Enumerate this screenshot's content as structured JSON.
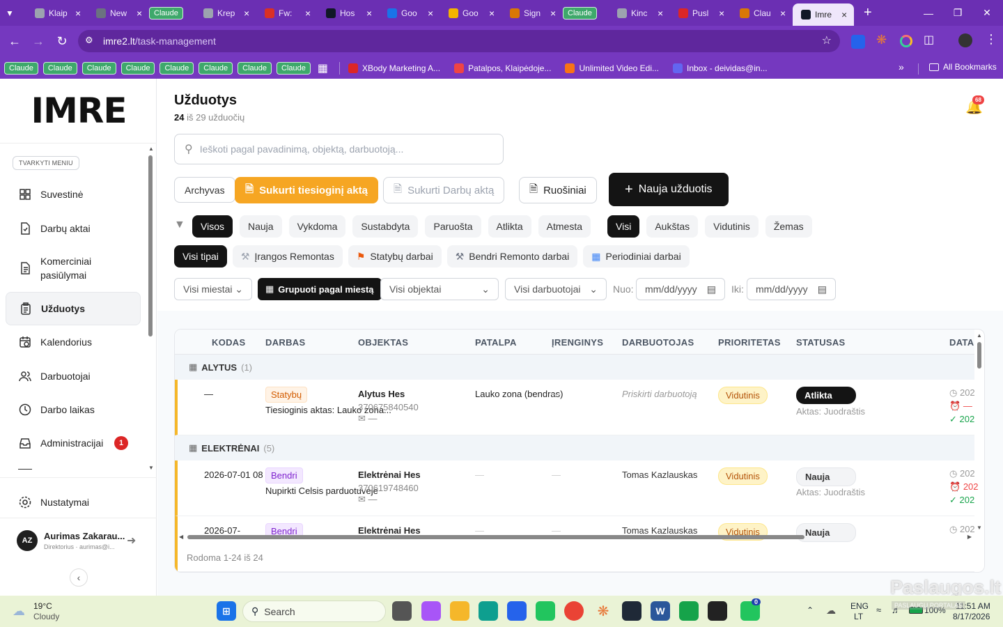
{
  "browser": {
    "tabs": [
      {
        "title": "Klaip",
        "color": "#9ca3af"
      },
      {
        "title": "New",
        "color": "#6b7280"
      },
      {
        "title": "Claude",
        "grouped": true
      },
      {
        "title": "Krep",
        "color": "#9ca3af"
      },
      {
        "title": "Fw:",
        "color": "#d93025"
      },
      {
        "title": "Hos",
        "color": "#111827"
      },
      {
        "title": "Goo",
        "color": "#1a73e8"
      },
      {
        "title": "Goo",
        "color": "#f4b400"
      },
      {
        "title": "Sign",
        "color": "#d97706"
      },
      {
        "title": "Claude",
        "grouped": true
      },
      {
        "title": "Kinc",
        "color": "#9ca3af"
      },
      {
        "title": "Pusl",
        "color": "#dc2626"
      },
      {
        "title": "Clau",
        "color": "#d97706"
      },
      {
        "title": "Imre",
        "color": "#111827",
        "active": true
      }
    ],
    "url_host": "imre2.lt",
    "url_path": "/task-management",
    "bookmarks": {
      "claude_chips": [
        "Claude",
        "Claude",
        "Claude",
        "Claude",
        "Claude",
        "Claude",
        "Claude",
        "Claude"
      ],
      "links": [
        {
          "label": "XBody Marketing A...",
          "color": "#dc2626"
        },
        {
          "label": "Patalpos, Klaipėdoje...",
          "color": "#ef4444"
        },
        {
          "label": "Unlimited Video Edi...",
          "color": "#f97316"
        },
        {
          "label": "Inbox - deividas@in...",
          "color": "#6366f1"
        }
      ],
      "all_bookmarks": "All Bookmarks"
    }
  },
  "sidebar": {
    "logo": "IMRE",
    "manage_menu": "TVARKYTI MENIU",
    "items": [
      {
        "label": "Suvestinė",
        "icon": "grid-icon"
      },
      {
        "label": "Darbų aktai",
        "icon": "document-check-icon"
      },
      {
        "label": "Komerciniai pasiūlymai",
        "icon": "document-text-icon"
      },
      {
        "label": "Užduotys",
        "icon": "clipboard-icon",
        "active": true
      },
      {
        "label": "Kalendorius",
        "icon": "calendar-icon"
      },
      {
        "label": "Darbuotojai",
        "icon": "users-icon"
      },
      {
        "label": "Darbo laikas",
        "icon": "clock-icon"
      },
      {
        "label": "Administracijai",
        "icon": "inbox-icon",
        "badge": "1"
      }
    ],
    "settings": "Nustatymai",
    "user": {
      "initials": "AZ",
      "name": "Aurimas Zakarau...",
      "role": "Direktorius · aurimas@i..."
    }
  },
  "header": {
    "title": "Užduotys",
    "count_shown": "24",
    "count_rest": "iš 29 užduočių",
    "notifications": "68"
  },
  "search": {
    "placeholder": "Ieškoti pagal pavadinimą, objektą, darbuotoją..."
  },
  "actions": {
    "archive": "Archyvas",
    "create_direct": "Sukurti tiesioginį aktą",
    "create_work": "Sukurti Darbų aktą",
    "drafts": "Ruošiniai",
    "new_task": "Nauja užduotis"
  },
  "status_filters": [
    "Visos",
    "Nauja",
    "Vykdoma",
    "Sustabdyta",
    "Paruošta",
    "Atlikta",
    "Atmesta"
  ],
  "status_filter_active": "Visos",
  "priority_filters": [
    "Visi",
    "Aukštas",
    "Vidutinis",
    "Žemas"
  ],
  "priority_filter_active": "Visi",
  "type_filters": [
    {
      "label": "Visi tipai",
      "active": true
    },
    {
      "label": "Įrangos Remontas",
      "icon": "wrench-icon"
    },
    {
      "label": "Statybų darbai",
      "icon": "crane-icon"
    },
    {
      "label": "Bendri Remonto darbai",
      "icon": "tools-icon"
    },
    {
      "label": "Periodiniai darbai",
      "icon": "calendar-icon"
    }
  ],
  "filters": {
    "city": "Visi miestai",
    "group_by_city": "Grupuoti pagal miestą",
    "objects": "Visi objektai",
    "employees": "Visi darbuotojai",
    "from_label": "Nuo:",
    "to_label": "Iki:",
    "date_placeholder": "mm/dd/yyyy"
  },
  "table": {
    "columns": [
      "KODAS",
      "DARBAS",
      "OBJEKTAS",
      "PATALPA",
      "ĮRENGINYS",
      "DARBUOTOJAS",
      "PRIORITETAS",
      "STATUSAS",
      "DATA"
    ],
    "groups": [
      {
        "name": "ALYTUS",
        "count": "(1)",
        "rows": [
          {
            "code": "—",
            "type": "Statybų",
            "task": "Tiesioginis aktas: Lauko zona...",
            "object": "Alytus Hes",
            "phone": "370675840540",
            "email": "—",
            "room": "Lauko zona (bendras)",
            "device": "—",
            "employee": "Priskirti darbuotoją",
            "priority": "Vidutinis",
            "status": "Atlikta",
            "act": "Aktas: Juodraštis",
            "dates": [
              "202",
              "—",
              "202"
            ]
          }
        ]
      },
      {
        "name": "ELEKTRĖNAI",
        "count": "(5)",
        "rows": [
          {
            "code": "2026-07-01 08",
            "type": "Bendri",
            "task": "Nupirkti Celsis parduotuvėje",
            "object": "Elektrėnai Hes",
            "phone": "370619748460",
            "email": "—",
            "room": "—",
            "device": "—",
            "employee": "Tomas Kazlauskas",
            "priority": "Vidutinis",
            "status": "Nauja",
            "act": "Aktas: Juodraštis",
            "dates": [
              "202",
              "202",
              "202"
            ]
          },
          {
            "code": "2026-07-",
            "type": "Bendri",
            "task": "",
            "object": "Elektrėnai Hes",
            "phone": "",
            "email": "",
            "room": "—",
            "device": "—",
            "employee": "Tomas Kazlauskas",
            "priority": "Vidutinis",
            "status": "Nauja",
            "act": "",
            "dates": [
              "202"
            ]
          }
        ]
      }
    ],
    "footer": "Rodoma 1-24 iš 24"
  },
  "taskbar": {
    "weather_temp": "19°C",
    "weather_desc": "Cloudy",
    "search": "Search",
    "lang": "ENG",
    "lang2": "LT",
    "battery": "100%",
    "time": "11:51 AM",
    "date": "8/17/2026",
    "whatsapp_badge": "0"
  },
  "watermark": {
    "text": "Paslaugos.lt",
    "subtext": "PASLAUGŲ PORTALAS"
  },
  "colors": {
    "accent": "#f5a623",
    "dark": "#141414",
    "chrome": "#7538bf",
    "taskbar": "#eaf3d6"
  }
}
